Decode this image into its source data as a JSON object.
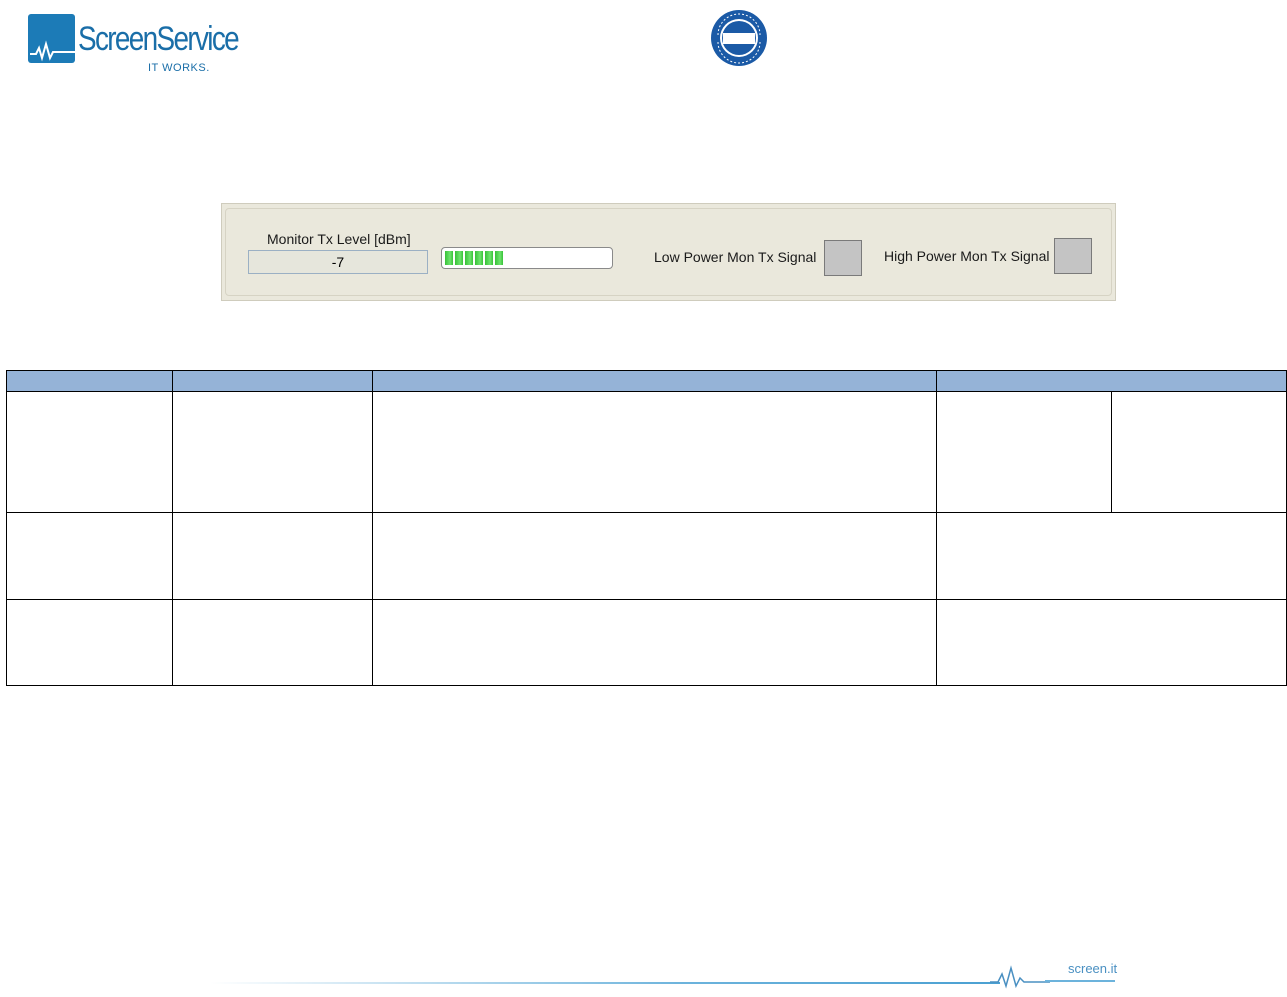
{
  "header": {
    "brand_name": "ScreenService",
    "tagline": "IT WORKS.",
    "certification_text": "CERTIFIED",
    "certification_brand": "IQNet"
  },
  "panel": {
    "tx_level_label": "Monitor Tx Level [dBm]",
    "tx_level_value": "-7",
    "tx_meter_fraction": 0.36,
    "low_power_label": "Low Power Mon Tx Signal",
    "high_power_label": "High Power Mon Tx Signal",
    "led_color": "#c4c4c4",
    "meter_color": "#38c238"
  },
  "table": {
    "header_color": "#95b3d7"
  },
  "footer": {
    "site": "screen.it"
  }
}
